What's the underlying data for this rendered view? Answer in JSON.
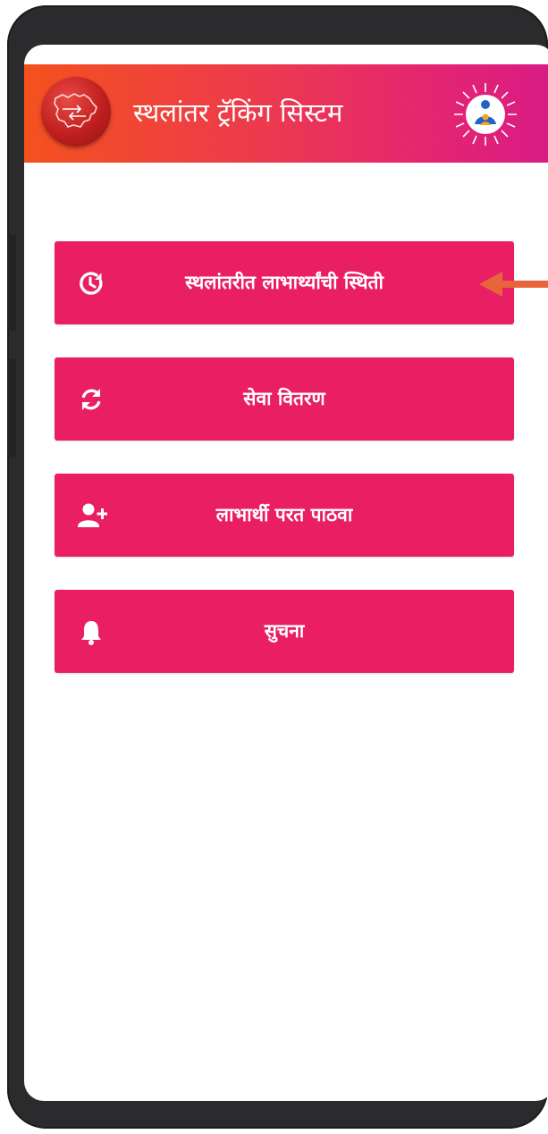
{
  "app": {
    "title": "स्थलांतर ट्रॅकिंग सिस्टम"
  },
  "menu": {
    "items": [
      {
        "label": "स्थलांतरीत लाभार्थ्यांची स्थिती",
        "icon": "history-icon"
      },
      {
        "label": "सेवा वितरण",
        "icon": "sync-icon"
      },
      {
        "label": "लाभार्थी परत पाठवा",
        "icon": "add-user-icon"
      },
      {
        "label": "सुचना",
        "icon": "bell-icon"
      }
    ]
  },
  "colors": {
    "header_start": "#f4511e",
    "header_end": "#d81b86",
    "button": "#e91e63",
    "pointer_arrow": "#e8643c",
    "phone_frame": "#2b2b2d"
  }
}
